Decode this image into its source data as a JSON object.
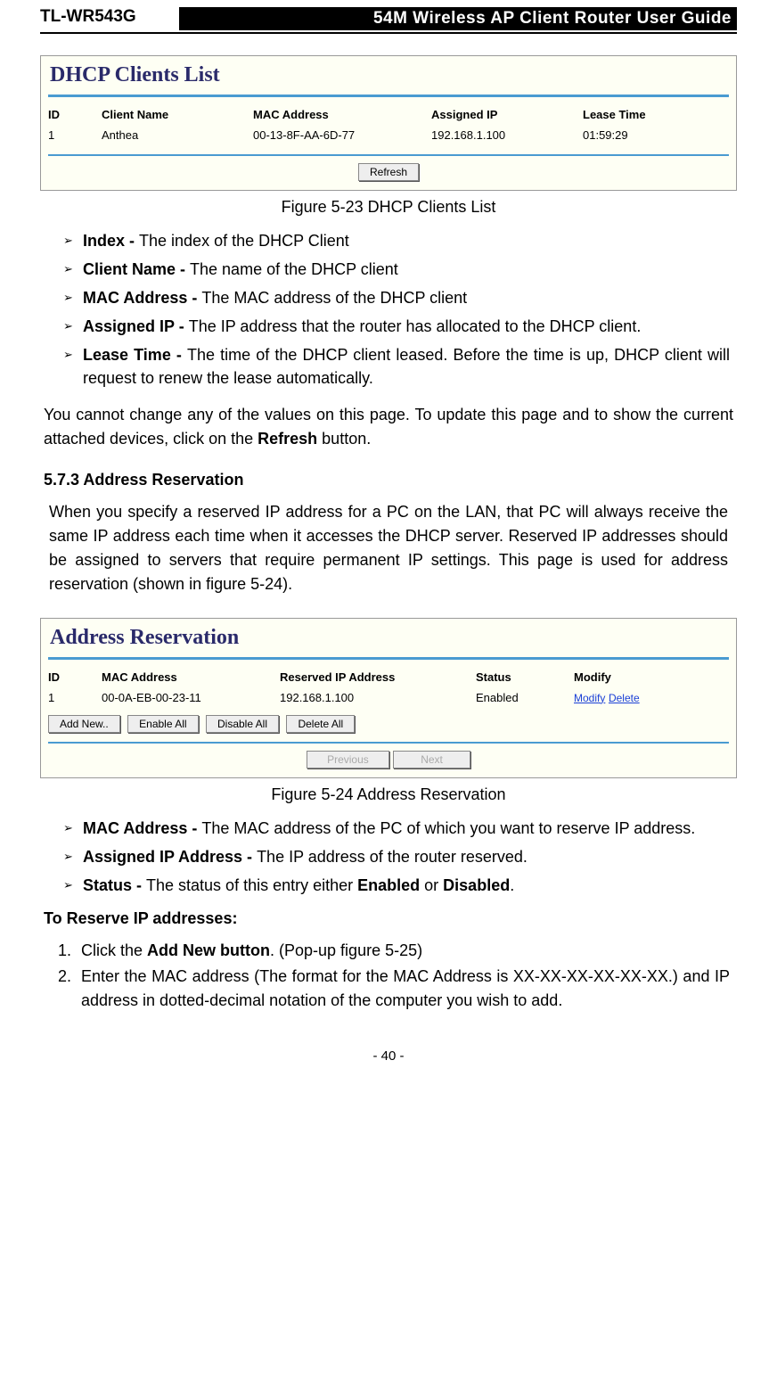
{
  "header": {
    "model": "TL-WR543G",
    "title": "54M Wireless AP Client Router User Guide"
  },
  "fig1": {
    "title": "DHCP Clients List",
    "cols": {
      "c1": "ID",
      "c2": "Client Name",
      "c3": "MAC Address",
      "c4": "Assigned IP",
      "c5": "Lease Time"
    },
    "row": {
      "id": "1",
      "name": "Anthea",
      "mac": "00-13-8F-AA-6D-77",
      "ip": "192.168.1.100",
      "lease": "01:59:29"
    },
    "refresh": "Refresh",
    "caption": "Figure 5-23    DHCP Clients List"
  },
  "bullets1": {
    "b1_term": "Index - ",
    "b1_desc": "The index of the DHCP Client",
    "b2_term": "Client Name - ",
    "b2_desc": "The name of the DHCP client",
    "b3_term": "MAC Address - ",
    "b3_desc": "The MAC address of the DHCP client",
    "b4_term": "Assigned IP - ",
    "b4_desc": "The IP address that the router has allocated to the DHCP client.",
    "b5_term": "Lease Time - ",
    "b5_desc_a": "The time of the DHCP client leased. Before the time is up, DHCP client will request to renew the lease automatically."
  },
  "para1_a": "You cannot change any of the values on this page. To update this page and to show the current attached devices, click on the ",
  "para1_strong": "Refresh",
  "para1_b": " button.",
  "section573": "5.7.3 Address Reservation",
  "para2": "When you specify a reserved IP address for a PC on the LAN, that PC will always receive the same IP address each time when it accesses the DHCP server. Reserved IP addresses should be assigned to servers that require permanent IP settings. This page is used for address reservation (shown in figure 5-24).",
  "fig2": {
    "title": "Address Reservation",
    "cols": {
      "c1": "ID",
      "c2": "MAC Address",
      "c3": "Reserved IP Address",
      "c4": "Status",
      "c5": "Modify"
    },
    "row": {
      "id": "1",
      "mac": "00-0A-EB-00-23-11",
      "ip": "192.168.1.100",
      "status": "Enabled",
      "modify": "Modify",
      "delete": "Delete"
    },
    "btns": {
      "addnew": "Add New..",
      "enall": "Enable All",
      "disall": "Disable All",
      "delall": "Delete All",
      "prev": "Previous",
      "next": "Next"
    },
    "caption": "Figure 5-24    Address Reservation"
  },
  "bullets2": {
    "b1_term": "MAC Address - ",
    "b1_desc": "The MAC address of the PC of which you want to reserve IP address.",
    "b2_term": "Assigned IP Address - ",
    "b2_desc": "The IP address of the router reserved.",
    "b3_term": "Status - ",
    "b3_desc_a": "The status of this entry either ",
    "b3_strong1": "Enabled",
    "b3_mid": " or ",
    "b3_strong2": "Disabled",
    "b3_end": "."
  },
  "reserve_head": "To Reserve IP addresses:",
  "steps": {
    "s1_a": "Click the ",
    "s1_strong": "Add New button",
    "s1_b": ". (Pop-up figure 5-25)",
    "s2": "Enter the MAC address (The format for the MAC Address is XX-XX-XX-XX-XX-XX.) and IP address in dotted-decimal notation of the computer you wish to add."
  },
  "pagenum": "- 40 -"
}
